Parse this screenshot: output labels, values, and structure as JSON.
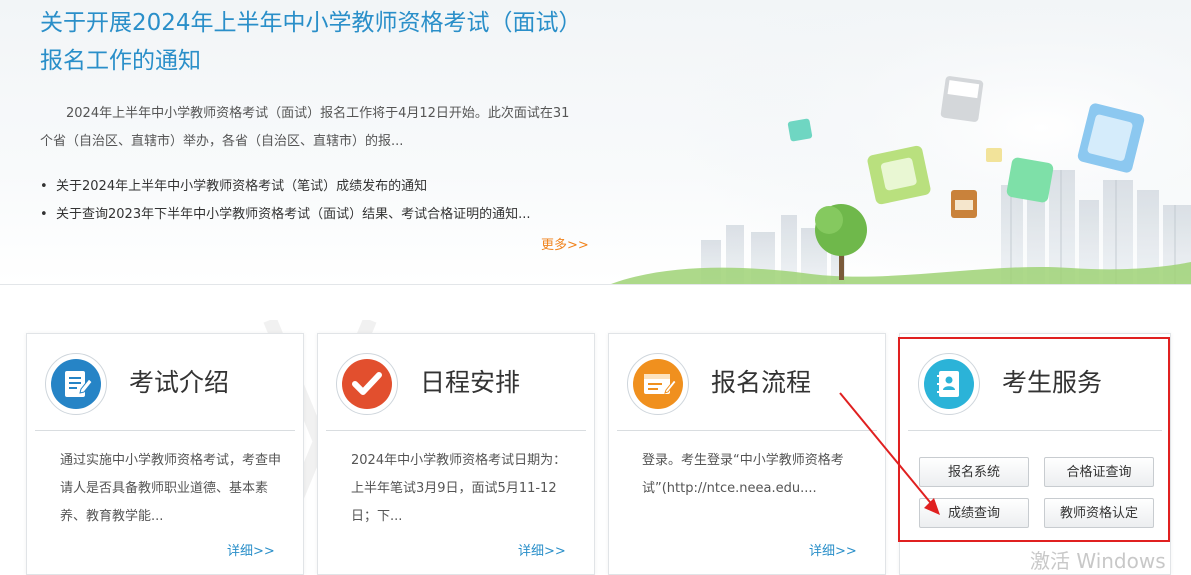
{
  "top": {
    "headline": "关于开展2024年上半年中小学教师资格考试（面试）报名工作的通知",
    "summary": "2024年上半年中小学教师资格考试（面试）报名工作将于4月12日开始。此次面试在31个省（自治区、直辖市）举办，各省（自治区、直辖市）的报...",
    "news": [
      "关于2024年上半年中小学教师资格考试（笔试）成绩发布的通知",
      "关于查询2023年下半年中小学教师资格考试（面试）结果、考试合格证明的通知..."
    ],
    "more_label": "更多>>"
  },
  "cards": [
    {
      "title": "考试介绍",
      "desc": "通过实施中小学教师资格考试，考查申请人是否具备教师职业道德、基本素养、教育教学能...",
      "detail": "详细>>"
    },
    {
      "title": "日程安排",
      "desc": "2024年中小学教师资格考试日期为：上半年笔试3月9日，面试5月11-12日；下...",
      "detail": "详细>>"
    },
    {
      "title": "报名流程",
      "desc": "登录。考生登录“中小学教师资格考试”(http://ntce.neea.edu....",
      "detail": "详细>>"
    }
  ],
  "service": {
    "title": "考生服务",
    "buttons": [
      "报名系统",
      "合格证查询",
      "成绩查询",
      "教师资格认定"
    ]
  },
  "watermark": "激活 Windows",
  "colors": {
    "accent_blue": "#2a8fc9",
    "more_orange": "#f0841e",
    "highlight_red": "#e02020"
  }
}
